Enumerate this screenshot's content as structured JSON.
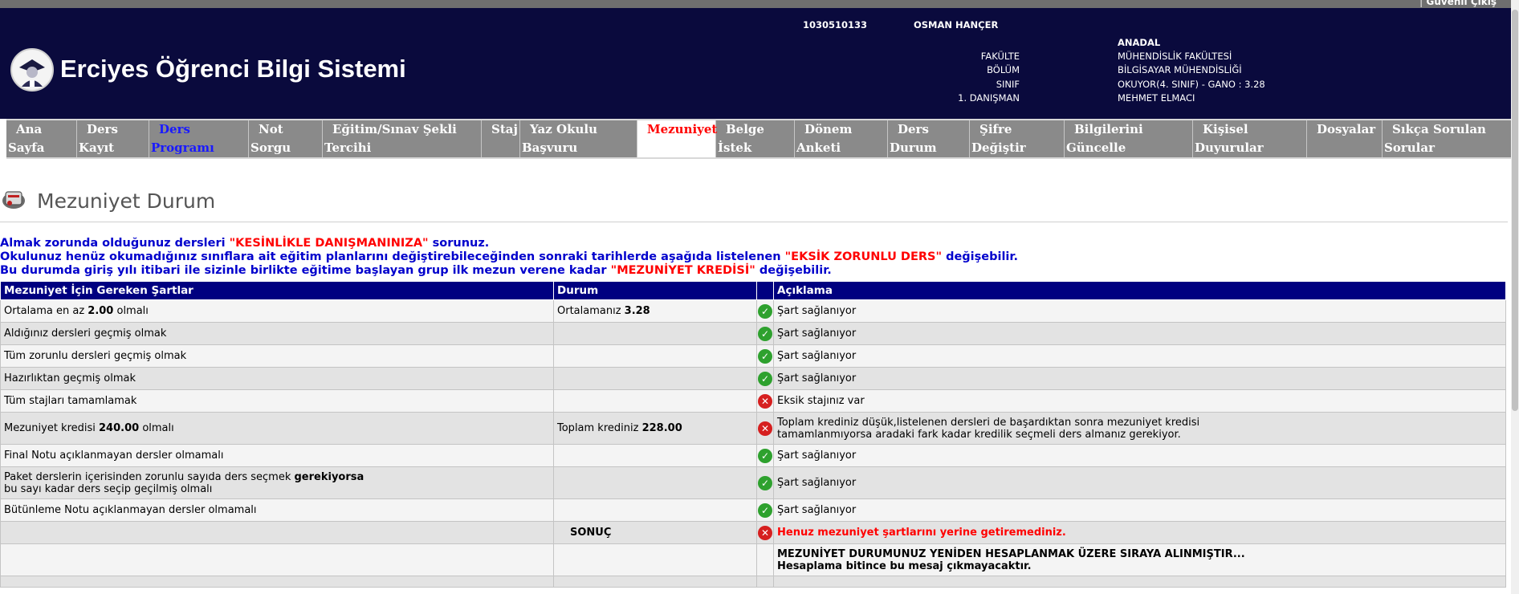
{
  "header": {
    "logout": "Güvenli Çıkış",
    "site_title": "Erciyes Öğrenci Bilgi Sistemi",
    "student_no": "1030510133",
    "student_name": "OSMAN HANÇER",
    "program_type": "ANADAL",
    "labels": [
      "FAKÜLTE",
      "BÖLÜM",
      "SINIF",
      "1. DANIŞMAN"
    ],
    "values": [
      "MÜHENDİSLİK FAKÜLTESİ",
      "BİLGİSAYAR MÜHENDİSLİĞİ",
      "OKUYOR(4. SINIF) - GANO : 3.28",
      "MEHMET ELMACI"
    ]
  },
  "nav": [
    {
      "l1": "Ana",
      "l2": "Sayfa"
    },
    {
      "l1": "Ders",
      "l2": "Kayıt"
    },
    {
      "l1": "Ders",
      "l2": "Programı"
    },
    {
      "l1": "Not",
      "l2": "Sorgu"
    },
    {
      "l1": "Eğitim/Sınav Şekli",
      "l2": "Tercihi"
    },
    {
      "l1": "Staj",
      "l2": ""
    },
    {
      "l1": "Yaz Okulu",
      "l2": "Başvuru"
    },
    {
      "l1": "Mezuniyet",
      "l2": ""
    },
    {
      "l1": "Belge",
      "l2": "İstek"
    },
    {
      "l1": "Dönem",
      "l2": "Anketi"
    },
    {
      "l1": "Ders",
      "l2": "Durum"
    },
    {
      "l1": "Şifre",
      "l2": "Değiştir"
    },
    {
      "l1": "Bilgilerini",
      "l2": "Güncelle"
    },
    {
      "l1": "Kişisel",
      "l2": "Duyurular"
    },
    {
      "l1": "Dosyalar",
      "l2": ""
    },
    {
      "l1": "Sıkça Sorulan",
      "l2": "Sorular"
    }
  ],
  "page_title": "Mezuniyet Durum",
  "warnings": {
    "w1_a": "Almak zorunda olduğunuz dersleri ",
    "w1_b": "\"KESİNLİKLE DANIŞMANINIZA\"",
    "w1_c": " sorunuz.",
    "w2_a": "Okulunuz henüz okumadığınız sınıflara ait eğitim planlarını değiştirebileceğinden sonraki tarihlerde aşağıda listelenen ",
    "w2_b": "\"EKSİK ZORUNLU DERS\"",
    "w2_c": " değişebilir.",
    "w3_a": "Bu durumda giriş yılı itibari ile sizinle birlikte eğitime başlayan grup ilk mezun verene kadar ",
    "w3_b": "\"MEZUNİYET KREDİSİ\"",
    "w3_c": " değişebilir."
  },
  "table": {
    "headers": [
      "Mezuniyet İçin Gereken Şartlar",
      "Durum",
      "",
      "Açıklama"
    ],
    "rows": [
      {
        "req_a": "Ortalama en az ",
        "req_b": "2.00",
        "req_c": " olmalı",
        "status_a": "Ortalamanız ",
        "status_b": "3.28",
        "ok": true,
        "desc": "Şart sağlanıyor"
      },
      {
        "req_a": "Aldığınız dersleri geçmiş olmak",
        "req_b": "",
        "req_c": "",
        "status_a": "",
        "status_b": "",
        "ok": true,
        "desc": "Şart sağlanıyor"
      },
      {
        "req_a": "Tüm zorunlu dersleri geçmiş olmak",
        "req_b": "",
        "req_c": "",
        "status_a": "",
        "status_b": "",
        "ok": true,
        "desc": "Şart sağlanıyor"
      },
      {
        "req_a": "Hazırlıktan geçmiş olmak",
        "req_b": "",
        "req_c": "",
        "status_a": "",
        "status_b": "",
        "ok": true,
        "desc": "Şart sağlanıyor"
      },
      {
        "req_a": "Tüm stajları tamamlamak",
        "req_b": "",
        "req_c": "",
        "status_a": "",
        "status_b": "",
        "ok": false,
        "desc": "Eksik stajınız var"
      },
      {
        "req_a": "Mezuniyet kredisi ",
        "req_b": "240.00",
        "req_c": " olmalı",
        "status_a": "Toplam krediniz ",
        "status_b": "228.00",
        "ok": false,
        "desc": "Toplam krediniz düşük,listelenen dersleri de başardıktan sonra mezuniyet kredisi",
        "desc2": "tamamlanmıyorsa aradaki fark kadar kredilik seçmeli ders almanız gerekiyor."
      },
      {
        "req_a": "Final Notu açıklanmayan dersler olmamalı",
        "req_b": "",
        "req_c": "",
        "status_a": "",
        "status_b": "",
        "ok": true,
        "desc": "Şart sağlanıyor"
      },
      {
        "req_a": "Paket derslerin içerisinden zorunlu sayıda ders seçmek ",
        "req_b": "gerekiyorsa",
        "req_c": "",
        "req_line2": "bu sayı kadar ders seçip geçilmiş olmalı",
        "status_a": "",
        "status_b": "",
        "ok": true,
        "desc": "Şart sağlanıyor"
      },
      {
        "req_a": "Bütünleme Notu açıklanmayan dersler olmamalı",
        "req_b": "",
        "req_c": "",
        "status_a": "",
        "status_b": "",
        "ok": true,
        "desc": "Şart sağlanıyor"
      }
    ],
    "result_label": "SONUÇ",
    "result_text": "Henuz mezuniyet şartlarını yerine getiremediniz.",
    "note_line1": "MEZUNİYET DURUMUNUZ YENİDEN HESAPLANMAK ÜZERE SIRAYA ALINMIŞTIR...",
    "note_line2": "Hesaplama bitince bu mesaj çıkmayacaktır."
  }
}
